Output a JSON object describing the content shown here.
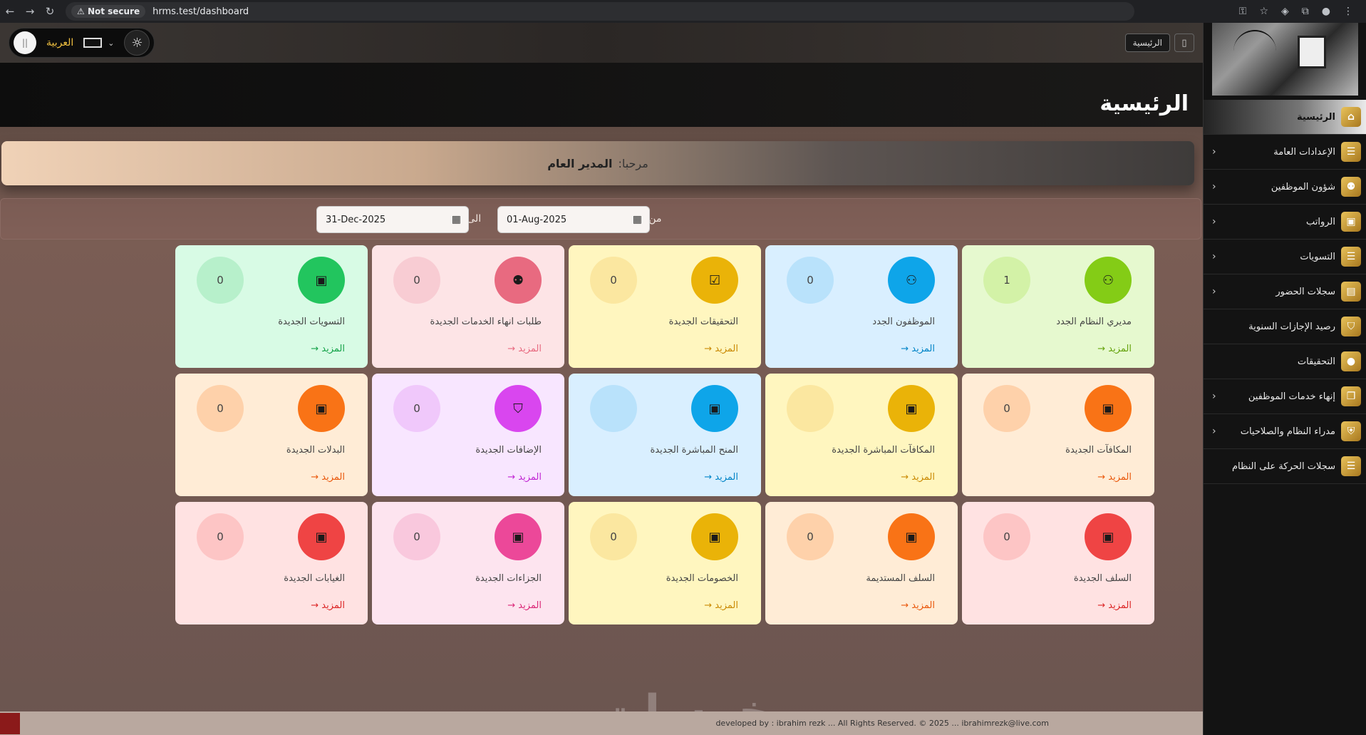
{
  "browser": {
    "not_secure": "Not secure",
    "url": "hrms.test/dashboard"
  },
  "topbar": {
    "language": "العربية",
    "breadcrumb": "الرئيسية"
  },
  "page": {
    "title": "الرئيسية",
    "welcome_prefix": "مرحبا:",
    "welcome_name": "المدير العام"
  },
  "filters": {
    "from_label": "من تاريخ",
    "from_value": "01-Aug-2025",
    "to_label": "الى تاريخ",
    "to_value": "31-Dec-2025"
  },
  "more_label": "المزيد →",
  "cards": [
    {
      "label": "مديري النظام الجدد",
      "count": "1",
      "icon": "user-plus-icon",
      "bg": "#e6f9cf",
      "icon_color": "#84cc16",
      "count_bg": "#d3f2a7",
      "more_color": "#65a30d"
    },
    {
      "label": "الموظفون الجدد",
      "count": "0",
      "icon": "user-plus-icon",
      "bg": "#d9efff",
      "icon_color": "#0ea5e9",
      "count_bg": "#b9e2fb",
      "more_color": "#0284c7"
    },
    {
      "label": "التحقيقات الجديدة",
      "count": "0",
      "icon": "clipboard-check-icon",
      "bg": "#fff6bf",
      "icon_color": "#eab308",
      "count_bg": "#fbe7a0",
      "more_color": "#ca8a04"
    },
    {
      "label": "طلبات انهاء الخدمات الجديدة",
      "count": "0",
      "icon": "users-icon",
      "bg": "#fde4e6",
      "icon_color": "#e86a80",
      "count_bg": "#f8ccd3",
      "more_color": "#e86a80"
    },
    {
      "label": "التسويات الجديدة",
      "count": "0",
      "icon": "money-icon",
      "bg": "#d8fbe5",
      "icon_color": "#22c55e",
      "count_bg": "#b7f0cb",
      "more_color": "#16a34a"
    },
    {
      "label": "المكافآت الجديدة",
      "count": "0",
      "icon": "money-icon",
      "bg": "#ffecd6",
      "icon_color": "#f97316",
      "count_bg": "#fed1aa",
      "more_color": "#ea580c"
    },
    {
      "label": "المكافآت المباشرة الجديدة",
      "count": "",
      "icon": "money-icon",
      "bg": "#fff6bf",
      "icon_color": "#eab308",
      "count_bg": "#fbe7a0",
      "more_color": "#ca8a04"
    },
    {
      "label": "المنح المباشرة الجديدة",
      "count": "",
      "icon": "money-icon",
      "bg": "#d9efff",
      "icon_color": "#0ea5e9",
      "count_bg": "#b9e2fb",
      "more_color": "#0284c7"
    },
    {
      "label": "الإضافات الجديدة",
      "count": "0",
      "icon": "bag-icon",
      "bg": "#f8e6ff",
      "icon_color": "#d946ef",
      "count_bg": "#f0c8fb",
      "more_color": "#c026d3"
    },
    {
      "label": "البدلات الجديدة",
      "count": "0",
      "icon": "money-icon",
      "bg": "#ffecd6",
      "icon_color": "#f97316",
      "count_bg": "#fed1aa",
      "more_color": "#ea580c"
    },
    {
      "label": "السلف الجديدة",
      "count": "0",
      "icon": "money-icon",
      "bg": "#ffe2e2",
      "icon_color": "#ef4444",
      "count_bg": "#fdc5c5",
      "more_color": "#dc2626"
    },
    {
      "label": "السلف المستديمة",
      "count": "0",
      "icon": "money-icon",
      "bg": "#ffecd6",
      "icon_color": "#f97316",
      "count_bg": "#fed1aa",
      "more_color": "#ea580c"
    },
    {
      "label": "الخصومات الجديدة",
      "count": "0",
      "icon": "money-icon",
      "bg": "#fff6bf",
      "icon_color": "#eab308",
      "count_bg": "#fbe7a0",
      "more_color": "#ca8a04"
    },
    {
      "label": "الجزاءات الجديدة",
      "count": "0",
      "icon": "money-icon",
      "bg": "#fde4ef",
      "icon_color": "#ec4899",
      "count_bg": "#f9c8dd",
      "more_color": "#db2777"
    },
    {
      "label": "الغيابات الجديدة",
      "count": "0",
      "icon": "money-icon",
      "bg": "#ffe2e2",
      "icon_color": "#ef4444",
      "count_bg": "#fdc5c5",
      "more_color": "#dc2626"
    }
  ],
  "sidebar": {
    "items": [
      {
        "label": "الرئيسية",
        "icon": "home-icon",
        "chevron": false,
        "active": true
      },
      {
        "label": "الإعدادات العامة",
        "icon": "sliders-icon",
        "chevron": true,
        "active": false
      },
      {
        "label": "شؤون الموظفين",
        "icon": "users-icon",
        "chevron": true,
        "active": false
      },
      {
        "label": "الرواتب",
        "icon": "money-icon",
        "chevron": true,
        "active": false
      },
      {
        "label": "التسويات",
        "icon": "list-icon",
        "chevron": true,
        "active": false
      },
      {
        "label": "سجلات الحضور",
        "icon": "calendar-icon",
        "chevron": true,
        "active": false
      },
      {
        "label": "رصيد الإجازات السنوية",
        "icon": "bag-icon",
        "chevron": false,
        "active": false
      },
      {
        "label": "التحقيقات",
        "icon": "circle-icon",
        "chevron": false,
        "active": false
      },
      {
        "label": "إنهاء خدمات الموظفين",
        "icon": "copy-icon",
        "chevron": true,
        "active": false
      },
      {
        "label": "مدراء النظام والصلاحيات",
        "icon": "shield-icon",
        "chevron": true,
        "active": false
      },
      {
        "label": "سجلات الحركة على النظام",
        "icon": "list-icon",
        "chevron": false,
        "active": false
      }
    ]
  },
  "footer": {
    "text": "developed by : ibrahim rezk ... All Rights Reserved. © 2025 ... ibrahimrezk@live.com"
  },
  "watermark": "خمسات"
}
